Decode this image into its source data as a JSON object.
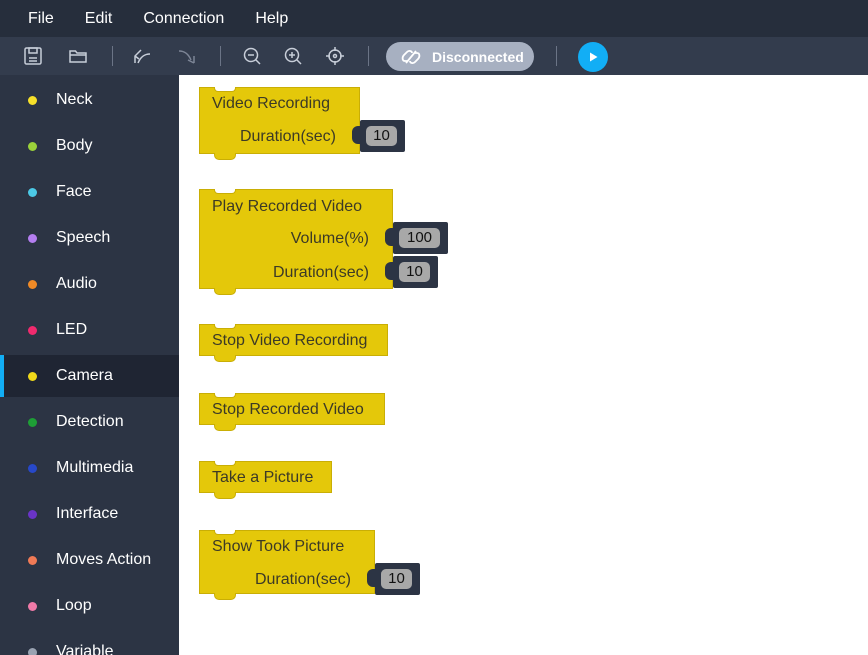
{
  "menu": [
    "File",
    "Edit",
    "Connection",
    "Help"
  ],
  "toolbar": {
    "icons": [
      "save-icon",
      "folder-icon",
      "undo-icon",
      "redo-icon",
      "zoom-out-icon",
      "zoom-in-icon",
      "recenter-icon"
    ],
    "connection_status": "Disconnected",
    "play_icon": "play-icon"
  },
  "sidebar": {
    "categories": [
      {
        "label": "Neck",
        "color": "#f7e02a"
      },
      {
        "label": "Body",
        "color": "#9bd13a"
      },
      {
        "label": "Face",
        "color": "#4cc9e6"
      },
      {
        "label": "Speech",
        "color": "#b47ef0"
      },
      {
        "label": "Audio",
        "color": "#f08a26"
      },
      {
        "label": "LED",
        "color": "#f02a6e"
      },
      {
        "label": "Camera",
        "color": "#f0d91a",
        "active": true
      },
      {
        "label": "Detection",
        "color": "#1e9e36"
      },
      {
        "label": "Multimedia",
        "color": "#2748c9"
      },
      {
        "label": "Interface",
        "color": "#6a34c8"
      },
      {
        "label": "Moves Action",
        "color": "#f07a56"
      },
      {
        "label": "Loop",
        "color": "#f07aa8"
      },
      {
        "label": "Variable",
        "color": "#9aa3b2"
      }
    ]
  },
  "blocks": {
    "video_recording": {
      "title": "Video Recording",
      "duration_label": "Duration(sec)",
      "duration_value": "10"
    },
    "play_recorded_video": {
      "title": "Play Recorded Video",
      "volume_label": "Volume(%)",
      "volume_value": "100",
      "duration_label": "Duration(sec)",
      "duration_value": "10"
    },
    "stop_video_recording": {
      "title": "Stop Video Recording"
    },
    "stop_recorded_video": {
      "title": "Stop Recorded Video"
    },
    "take_picture": {
      "title": "Take a Picture"
    },
    "show_took_picture": {
      "title": "Show Took Picture",
      "duration_label": "Duration(sec)",
      "duration_value": "10"
    }
  }
}
